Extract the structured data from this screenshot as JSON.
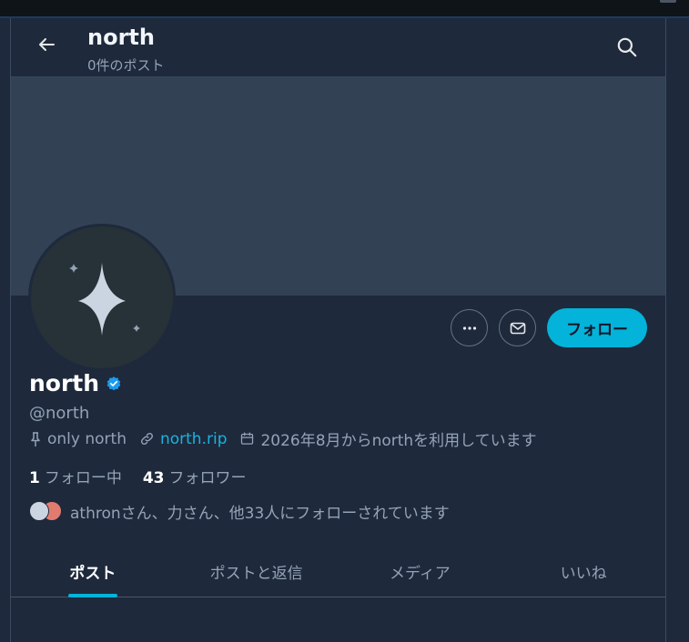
{
  "header": {
    "name": "north",
    "post_count": "0件のポスト"
  },
  "profile": {
    "display_name": "north",
    "handle": "@north",
    "location": "only north",
    "website": "north.rip",
    "joined": "2026年8月からnorthを利用しています",
    "following_count": "1",
    "following_label": "フォロー中",
    "followers_count": "43",
    "followers_label": "フォロワー",
    "followed_by": "athronさん、力さん、他33人にフォローされています",
    "follow_button": "フォロー"
  },
  "tabs": [
    {
      "label": "ポスト",
      "active": true
    },
    {
      "label": "ポストと返信",
      "active": false
    },
    {
      "label": "メディア",
      "active": false
    },
    {
      "label": "いいね",
      "active": false
    }
  ],
  "icons": {
    "back": "back-arrow-icon",
    "search": "search-icon",
    "more": "more-icon",
    "message": "mail-icon",
    "verified": "verified-badge-icon",
    "location": "pin-icon",
    "link": "link-icon",
    "calendar": "calendar-icon",
    "avatar_art": "sparkle-icon"
  },
  "colors": {
    "accent": "#03b3d9",
    "background": "#1e293b",
    "banner": "#334155",
    "verified": "#1d9bf0"
  }
}
